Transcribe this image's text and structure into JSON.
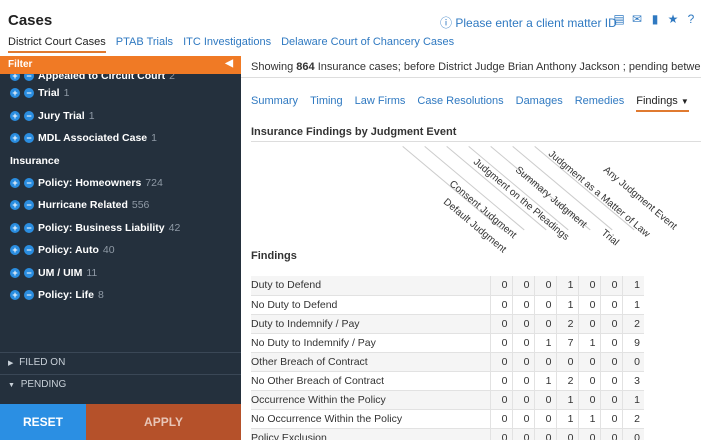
{
  "header": {
    "title": "Cases",
    "warning": "Please enter a client matter ID",
    "icons": [
      "chart-icon",
      "mail-icon",
      "document-icon",
      "star-icon",
      "help-icon"
    ]
  },
  "topnav": [
    "District Court Cases",
    "PTAB Trials",
    "ITC Investigations",
    "Delaware Court of Chancery Cases"
  ],
  "sidebar": {
    "filter_label": "Filter",
    "items": [
      {
        "label": "Appealed to Circuit Court",
        "count": "2"
      },
      {
        "label": "Trial",
        "count": "1"
      },
      {
        "label": "Jury Trial",
        "count": "1"
      },
      {
        "label": "MDL Associated Case",
        "count": "1"
      }
    ],
    "insurance_heading": "Insurance",
    "insurance_items": [
      {
        "label": "Policy: Homeowners",
        "count": "724"
      },
      {
        "label": "Hurricane Related",
        "count": "556"
      },
      {
        "label": "Policy: Business Liability",
        "count": "42"
      },
      {
        "label": "Policy: Auto",
        "count": "40"
      },
      {
        "label": "UM / UIM",
        "count": "11"
      },
      {
        "label": "Policy: Life",
        "count": "8"
      }
    ],
    "filed_on": "FILED ON",
    "pending": "PENDING",
    "reset": "RESET",
    "apply": "APPLY"
  },
  "main": {
    "showing_prefix": "Showing",
    "showing_count": "864",
    "showing_rest": "Insurance  cases;  before District Judge Brian Anthony Jackson ;  pending between",
    "tabs": [
      "Summary",
      "Timing",
      "Law Firms",
      "Case Resolutions",
      "Damages",
      "Remedies",
      "Findings"
    ],
    "table_title": "Insurance Findings by Judgment Event",
    "findings_header": "Findings",
    "columns": [
      "Default Judgment",
      "Consent Judgment",
      "Judgment on the Pleadings",
      "Summary Judgment",
      "Trial",
      "Judgment as a Matter of Law",
      "Any Judgment Event"
    ],
    "rows": [
      {
        "label": "Duty to Defend",
        "values": [
          "0",
          "0",
          "0",
          "1",
          "0",
          "0",
          "1"
        ]
      },
      {
        "label": "No Duty to Defend",
        "values": [
          "0",
          "0",
          "0",
          "1",
          "0",
          "0",
          "1"
        ]
      },
      {
        "label": "Duty to Indemnify / Pay",
        "values": [
          "0",
          "0",
          "0",
          "2",
          "0",
          "0",
          "2"
        ]
      },
      {
        "label": "No Duty to Indemnify / Pay",
        "values": [
          "0",
          "0",
          "1",
          "7",
          "1",
          "0",
          "9"
        ]
      },
      {
        "label": "Other Breach of Contract",
        "values": [
          "0",
          "0",
          "0",
          "0",
          "0",
          "0",
          "0"
        ]
      },
      {
        "label": "No Other Breach of Contract",
        "values": [
          "0",
          "0",
          "1",
          "2",
          "0",
          "0",
          "3"
        ]
      },
      {
        "label": "Occurrence Within the Policy",
        "values": [
          "0",
          "0",
          "0",
          "1",
          "0",
          "0",
          "1"
        ]
      },
      {
        "label": "No Occurrence Within the Policy",
        "values": [
          "0",
          "0",
          "0",
          "1",
          "1",
          "0",
          "2"
        ]
      },
      {
        "label": "Policy Exclusion",
        "values": [
          "0",
          "0",
          "0",
          "0",
          "0",
          "0",
          "0"
        ]
      }
    ]
  }
}
